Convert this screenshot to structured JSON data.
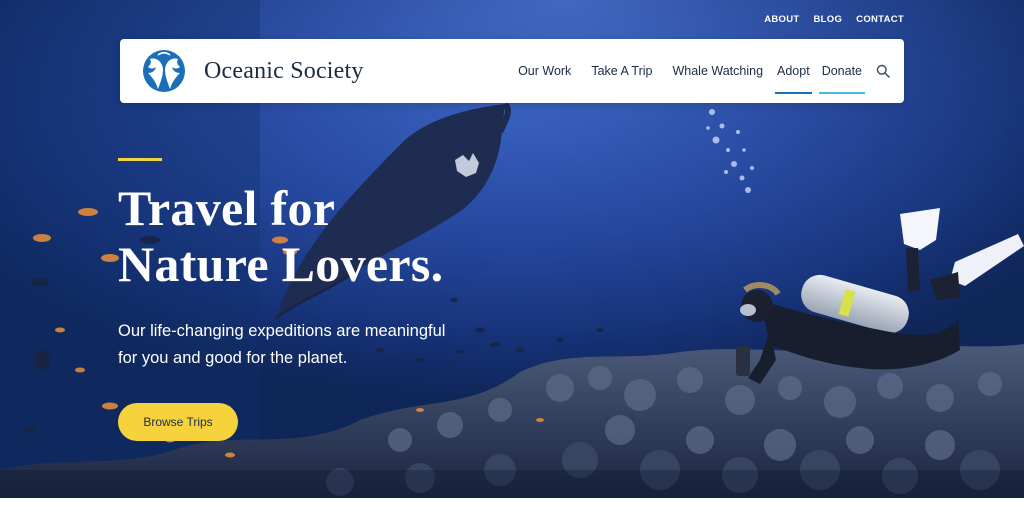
{
  "utility_nav": {
    "about": "ABOUT",
    "blog": "BLOG",
    "contact": "CONTACT"
  },
  "header": {
    "logo_text": "Oceanic Society",
    "logo_icon": "dolphins-logo-icon",
    "nav": [
      {
        "label": "Our Work"
      },
      {
        "label": "Take A Trip"
      },
      {
        "label": "Whale Watching"
      },
      {
        "label": "Adopt"
      },
      {
        "label": "Donate"
      }
    ],
    "search_icon": "search-icon"
  },
  "hero": {
    "title_line1": "Travel for",
    "title_line2": "Nature Lovers.",
    "subtitle_line1": "Our life-changing expeditions are meaningful",
    "subtitle_line2": "for you and good for the planet.",
    "cta_label": "Browse Trips"
  },
  "colors": {
    "accent_yellow": "#f6d33c",
    "brand_blue": "#1b6fb8",
    "donate_underline": "#46b7e6",
    "text_dark": "#1c2c44",
    "ocean_blue": "#23459c"
  }
}
